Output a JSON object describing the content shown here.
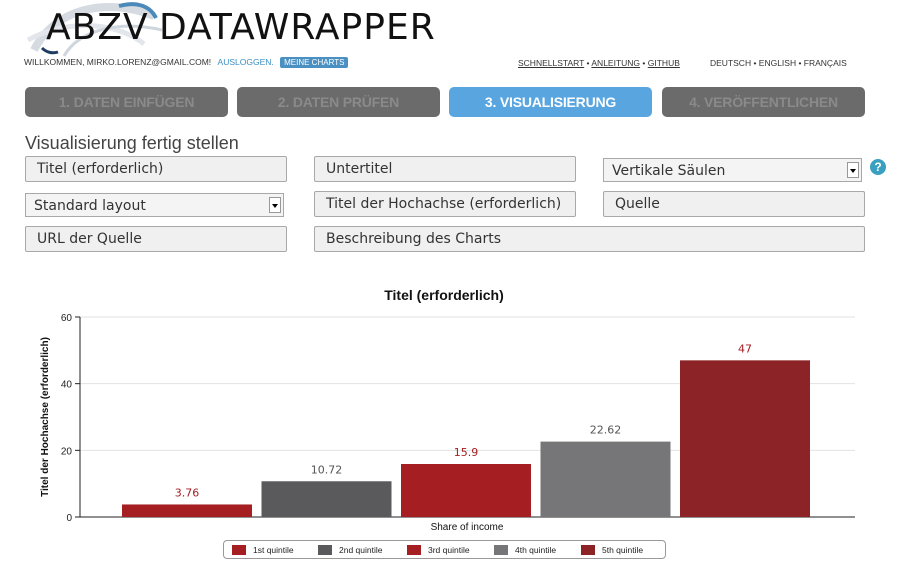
{
  "header": {
    "logo_abzv": "ABZV",
    "logo_datawrapper": "DATAWRAPPER",
    "welcome": "WILLKOMMEN, MIRKO.LORENZ@GMAIL.COM!",
    "logout": "AUSLOGGEN.",
    "my_charts": "MEINE CHARTS",
    "links": [
      "SCHNELLSTART",
      "ANLEITUNG",
      "GITHUB"
    ],
    "languages": "DEUTSCH • ENGLISH • FRANÇAIS"
  },
  "steps": [
    {
      "label": "1. DATEN EINFÜGEN",
      "active": false
    },
    {
      "label": "2. DATEN PRÜFEN",
      "active": false
    },
    {
      "label": "3. VISUALISIERUNG",
      "active": true
    },
    {
      "label": "4. VERÖFFENTLICHEN",
      "active": false
    }
  ],
  "section_title": "Visualisierung fertig stellen",
  "form": {
    "title_placeholder": "Titel (erforderlich)",
    "subtitle_placeholder": "Untertitel",
    "chart_type": "Vertikale Säulen",
    "layout": "Standard layout",
    "y_axis_placeholder": "Titel der Hochachse (erforderlich)",
    "source_placeholder": "Quelle",
    "source_url_placeholder": "URL der Quelle",
    "description_placeholder": "Beschreibung des Charts",
    "help": "?"
  },
  "chart_data": {
    "type": "bar",
    "title": "Titel (erforderlich)",
    "xlabel": "Share of income",
    "ylabel": "Titel der Hochachse (erforderlich)",
    "ylim": [
      0,
      60
    ],
    "yticks": [
      0,
      20,
      40,
      60
    ],
    "grid": true,
    "legend_position": "bottom",
    "categories": [
      "1st quintile",
      "2nd quintile",
      "3rd quintile",
      "4th quintile",
      "5th quintile"
    ],
    "values": [
      3.76,
      10.72,
      15.9,
      22.62,
      47
    ],
    "value_labels": [
      "3.76",
      "10.72",
      "15.9",
      "22.62",
      "47"
    ],
    "colors": [
      "#a41e22",
      "#5a595c",
      "#a41e22",
      "#767577",
      "#8c2427"
    ]
  }
}
